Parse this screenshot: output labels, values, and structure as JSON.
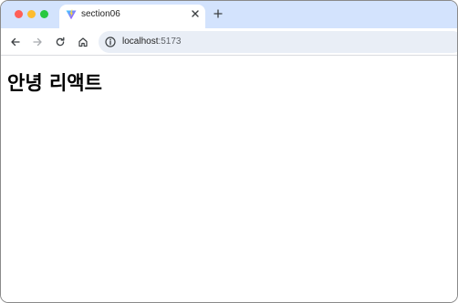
{
  "browser": {
    "tab": {
      "title": "section06",
      "favicon": "vite-logo-icon"
    },
    "address_bar": {
      "host": "localhost",
      "port": ":5173"
    },
    "colors": {
      "tabbar_bg": "#d3e3fd",
      "omnibox_bg": "#e9eef6"
    }
  },
  "page": {
    "heading": "안녕 리액트"
  }
}
